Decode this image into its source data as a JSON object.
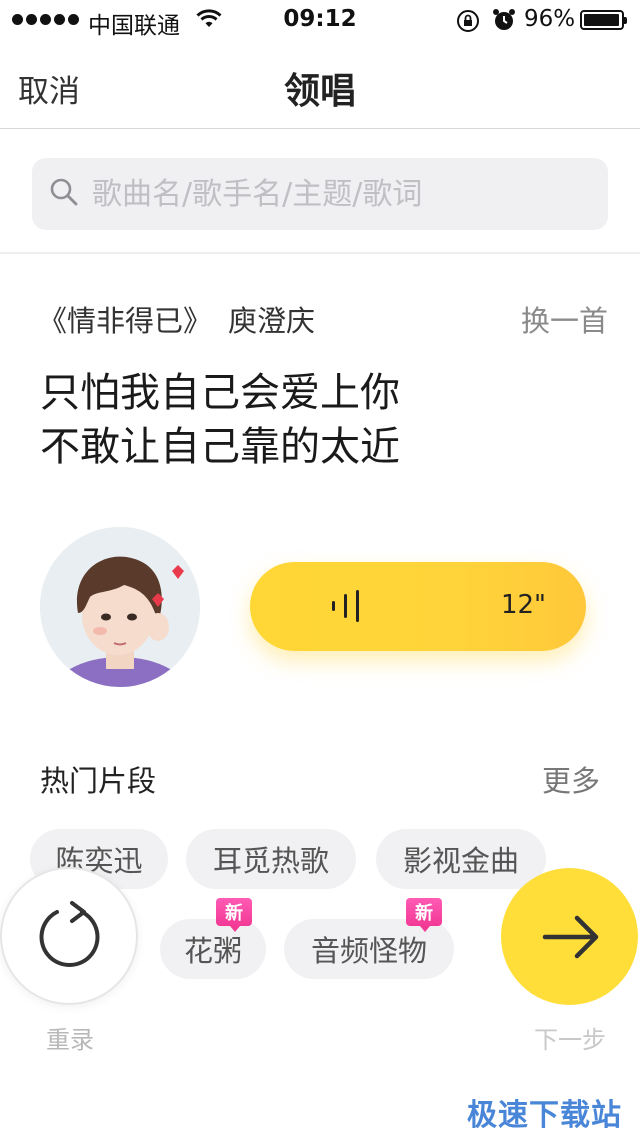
{
  "status_bar": {
    "carrier": "中国联通",
    "time": "09:12",
    "battery_percent": "96%",
    "battery_level": 0.96,
    "icons": [
      "signal-dots",
      "wifi-icon",
      "rotation-lock-icon",
      "alarm-icon",
      "battery-icon"
    ]
  },
  "nav": {
    "cancel_label": "取消",
    "title": "领唱"
  },
  "search": {
    "placeholder": "歌曲名/歌手名/主题/歌词"
  },
  "song": {
    "title": "《情非得已》",
    "artist": "庾澄庆",
    "switch_label": "换一首",
    "lyrics": [
      "只怕我自己会爱上你",
      "不敢让自己靠的太近"
    ]
  },
  "voice": {
    "duration": "12\""
  },
  "hot": {
    "title": "热门片段",
    "more_label": "更多",
    "chips": [
      {
        "label": "陈奕迅",
        "new": false
      },
      {
        "label": "耳觅热歌",
        "new": false
      },
      {
        "label": "影视金曲",
        "new": false
      },
      {
        "label": "花粥",
        "new": true
      },
      {
        "label": "音频怪物",
        "new": true
      }
    ],
    "new_badge_label": "新"
  },
  "actions": {
    "rerecord_label": "重录",
    "next_label": "下一步"
  },
  "watermark": "极速下载站",
  "colors": {
    "accent_yellow": "#ffd735",
    "new_badge_pink": "#f23a95",
    "watermark_blue": "#4a86d8"
  }
}
